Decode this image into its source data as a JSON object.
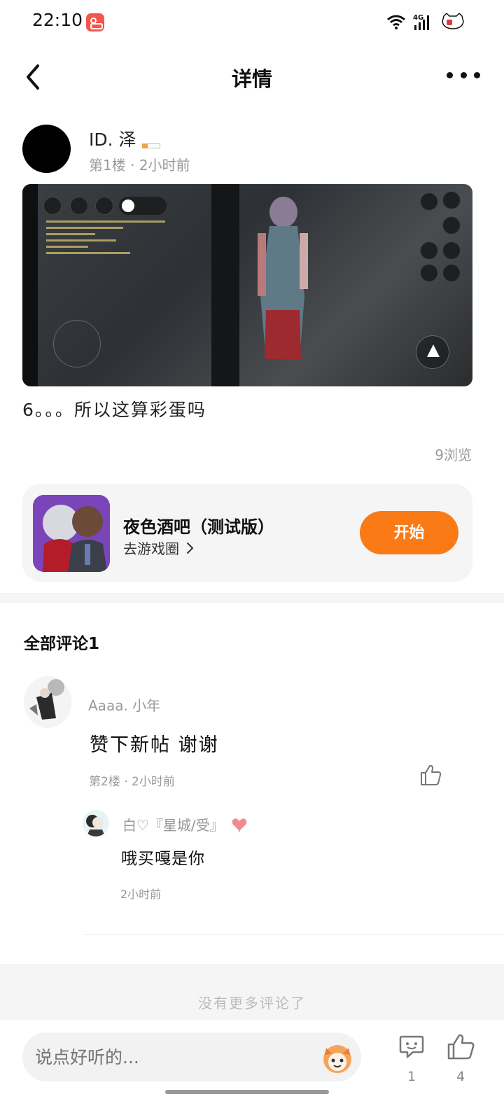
{
  "status_bar": {
    "time": "22:10",
    "network": "4G",
    "icons": [
      "app-notification-icon",
      "wifi-icon",
      "signal-icon",
      "battery-icon"
    ]
  },
  "nav": {
    "title": "详情",
    "back_icon": "chevron-left-icon",
    "more_icon": "more-dots-icon"
  },
  "post": {
    "author": {
      "name": "ID. 泽"
    },
    "floor": "第1楼",
    "time": "2小时前",
    "text": "6。。。所以这算彩蛋吗",
    "views": "9浏览"
  },
  "game_card": {
    "title": "夜色酒吧（测试版）",
    "link_label": "去游戏圈",
    "start_label": "开始"
  },
  "comments": {
    "header": "全部评论1",
    "items": [
      {
        "author": "Aaaa. 小年",
        "text": "赞下新帖 谢谢",
        "floor": "第2楼",
        "time": "2小时前",
        "replies": [
          {
            "author": "白♡『星城/受』",
            "text": "哦买嘎是你",
            "time": "2小时前"
          }
        ]
      }
    ],
    "end_text": "没有更多评论了"
  },
  "bottom_bar": {
    "input_placeholder": "说点好听的...",
    "comment_count": "1",
    "like_count": "4"
  },
  "colors": {
    "accent": "#fa7a16",
    "muted_text": "#999999",
    "card_background": "#f5f5f5"
  }
}
